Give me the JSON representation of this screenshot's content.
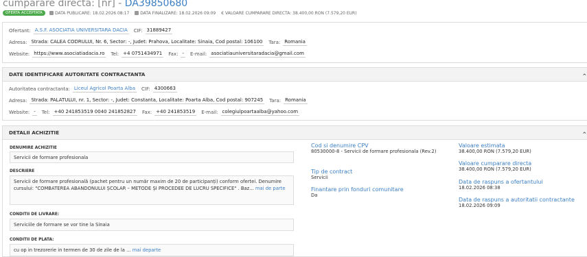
{
  "header": {
    "title_prefix": "cumparare directa: [nr] - ",
    "title_number": "DA39850680",
    "badge": "OFERTA ACCEPTATA",
    "date_pub": "DATA PUBLICARE: 18.02.2026 08:17",
    "date_fin": "DATA FINALIZARE: 18.02.2026 09:09",
    "valoare": "€ VALOARE CUMPARARE DIRECTA: 38.400,00  RON (7.579,20  EUR)"
  },
  "ofertant": {
    "label_name": "Ofertant:",
    "name": "A.S.F. ASOCIATIA UNIVERSITARA DACIA",
    "label_cif": "CIF:",
    "cif": "31889427",
    "label_adresa": "Adresa:",
    "adresa": "Strada: CALEA CODRULUI, Nr. 6, Sector: -, Judet: Prahova, Localitate: Sinaia, Cod postal: 106100",
    "label_tara": "Tara:",
    "tara": "Romania",
    "label_web": "Website:",
    "web": "https://www.asociatiadacia.ro",
    "label_tel": "Tel:",
    "tel": "+4 0751434971",
    "label_fax": "Fax:",
    "fax": "-",
    "label_email": "E-mail:",
    "email": "asociatiauniversitaradacia@gmail.com"
  },
  "autoritate": {
    "heading": "DATE IDENTIFICARE AUTORITATE CONTRACTANTA",
    "label_name": "Autoritatea contractanta:",
    "name": "Liceul Agricol Poarta Alba",
    "label_cif": "CIF:",
    "cif": "4300663",
    "label_adresa": "Adresa:",
    "adresa": "Strada: PALATULUI, nr. 1, Sector: -, Judet: Constanta, Localitate: Poarta Alba, Cod postal: 907245",
    "label_tara": "Tara:",
    "tara": "Romania",
    "label_web": "Website:",
    "web": "-",
    "label_tel": "Tel:",
    "tel": "+40 241853519 0040 241852827",
    "label_fax": "Fax:",
    "fax": "+40 241853519",
    "label_email": "E-mail:",
    "email": "colegiulpoartaalba@yahoo.com"
  },
  "detalii": {
    "heading": "DETALII ACHIZITIE",
    "den_label": "DENUMIRE ACHIZITIE",
    "den_value": "Servicii de formare profesionala",
    "desc_label": "DESCRIERE",
    "desc_value": "Servicii de formare profesională (pachet pentru un număr maxim de 20 de participanți) conform ofertei. Denumire cursului: \"COMBATEREA ABANDONULUI ȘCOLAR – METODE ȘI PROCEDEE DE LUCRU SPECIFICE\" . Baz...",
    "more": "mai de parte",
    "livrare_label": "CONDITII DE LIVRARE:",
    "livrare_value": "Serviciile de formare se vor tine la Sinaia",
    "plata_label": "CONDITII DE PLATA:",
    "plata_value": "cu op in trezorerie in termen de 30 de zile de la ...",
    "plata_more": "mai departe",
    "cpv_title": "Cod si denumire CPV",
    "cpv_value": "80530000-8 - Servicii de formare profesionala (Rev.2)",
    "tip_title": "Tip de contract",
    "tip_value": "Servicii",
    "fin_title": "Finantare prin fonduri comunitare",
    "fin_value": "Da",
    "val_est_title": "Valoare estimata",
    "val_est_value": "38.400,00  RON (7.579,20  EUR)",
    "val_cd_title": "Valoare cumparare directa",
    "val_cd_value": "38.400,00  RON (7.579,20  EUR)",
    "raspuns_of_title": "Data de raspuns a ofertantului",
    "raspuns_of_value": "18.02.2026 08:38",
    "raspuns_ac_title": "Data de raspuns a autoritatii contractante",
    "raspuns_ac_value": "18.02.2026 09:09"
  }
}
